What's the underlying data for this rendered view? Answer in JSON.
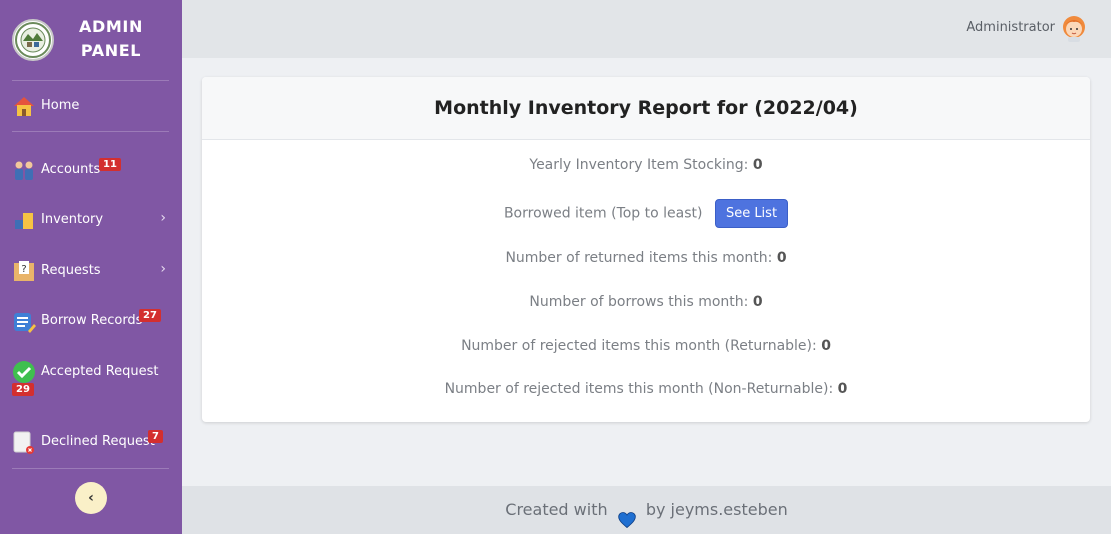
{
  "brand": {
    "title_line1": "ADMIN",
    "title_line2": "PANEL",
    "logo_icon": "seal-logo-icon"
  },
  "sidebar": {
    "items": [
      {
        "label": "Home",
        "icon": "home-icon"
      },
      {
        "label": "Accounts",
        "icon": "users-icon",
        "badge": "11"
      },
      {
        "label": "Inventory",
        "icon": "boxes-icon",
        "chevron": "›"
      },
      {
        "label": "Requests",
        "icon": "question-box-icon",
        "chevron": "›"
      },
      {
        "label": "Borrow Records",
        "icon": "records-icon",
        "badge": "27"
      },
      {
        "label": "Accepted Request",
        "icon": "check-circle-icon",
        "badge": "29"
      },
      {
        "label": "Declined Request",
        "icon": "declined-doc-icon",
        "badge": "7"
      }
    ],
    "collapse_label": "‹"
  },
  "topbar": {
    "user_name": "Administrator",
    "avatar_icon": "user-avatar-icon"
  },
  "report": {
    "title": "Monthly Inventory Report for (2022/04)",
    "yearly_stocking_label": "Yearly Inventory Item Stocking:",
    "yearly_stocking_value": "0",
    "borrowed_label": "Borrowed item (Top to least)",
    "see_list_label": "See List",
    "returned_label": "Number of returned items this month:",
    "returned_value": "0",
    "borrows_label": "Number of borrows this month:",
    "borrows_value": "0",
    "rejected_ret_label": "Number of rejected items this month (Returnable):",
    "rejected_ret_value": "0",
    "rejected_nonret_label": "Number of rejected items this month (Non-Returnable):",
    "rejected_nonret_value": "0"
  },
  "footer": {
    "prefix": "Created with",
    "suffix": "by jeyms.esteben",
    "heart_icon": "heart-icon"
  },
  "colors": {
    "sidebar": "#8057a4",
    "accent": "#4e73df",
    "badge": "#d32f2f"
  }
}
